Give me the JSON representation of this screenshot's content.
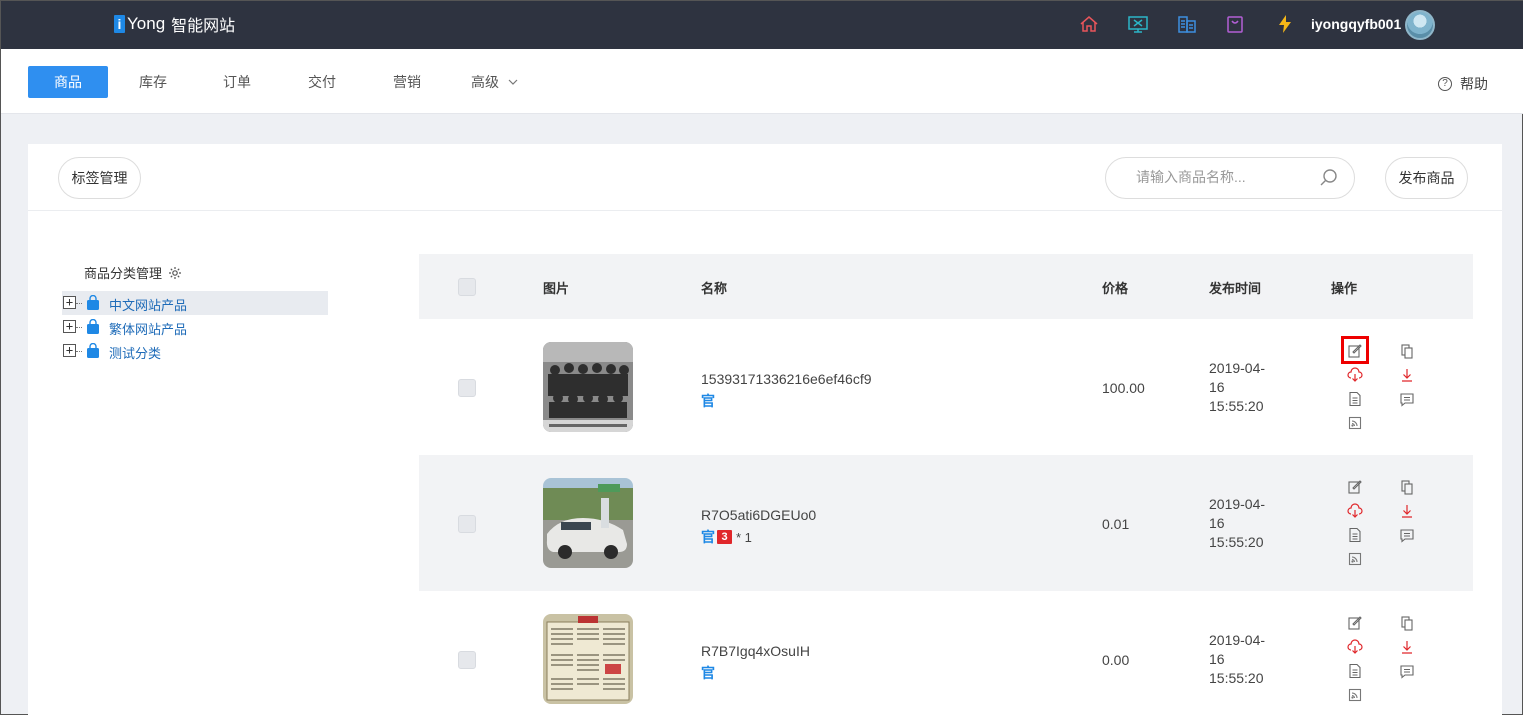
{
  "app": {
    "logo_letter": "i",
    "brand": "Yong",
    "subtitle": "智能网站",
    "username": "iyongqyfb001"
  },
  "header_icons": [
    "home-icon",
    "monitor-icon",
    "building-icon",
    "shopping-bag-icon",
    "lightning-icon"
  ],
  "colors": {
    "accent": "#2f8ff0",
    "topbar": "#2e3340",
    "link": "#1e6bb8",
    "danger": "#e0262a"
  },
  "nav": {
    "items": [
      "商品",
      "库存",
      "订单",
      "交付",
      "营销",
      "高级"
    ],
    "help": "帮助"
  },
  "toolbar": {
    "tag_manage": "标签管理",
    "search_placeholder": "请输入商品名称...",
    "publish": "发布商品"
  },
  "categories": {
    "title": "商品分类管理",
    "items": [
      "中文网站产品",
      "繁体网站产品",
      "测试分类"
    ]
  },
  "table": {
    "headers": {
      "image": "图片",
      "name": "名称",
      "price": "价格",
      "date": "发布时间",
      "actions": "操作"
    },
    "rows": [
      {
        "name": "15393171336216e6ef46cf9",
        "badge": "官",
        "badge3d": "",
        "count": "",
        "price": "100.00",
        "date": "2019-04-16 15:55:20"
      },
      {
        "name": "R7O5ati6DGEUo0",
        "badge": "官",
        "badge3d": "3",
        "count": "* 1",
        "price": "0.01",
        "date": "2019-04-16 15:55:20"
      },
      {
        "name": "R7B7Igq4xOsuIH",
        "badge": "官",
        "badge3d": "",
        "count": "",
        "price": "0.00",
        "date": "2019-04-16 15:55:20"
      }
    ]
  }
}
